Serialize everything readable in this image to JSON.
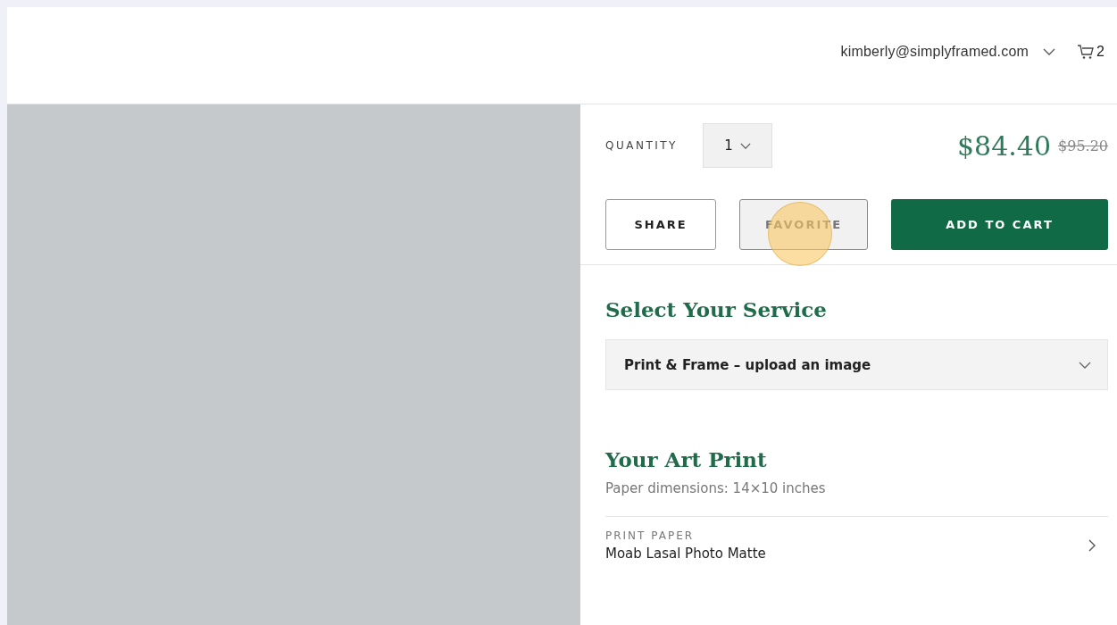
{
  "header": {
    "account_email": "kimberly@simplyframed.com",
    "cart_count": "2"
  },
  "purchase": {
    "quantity_label": "QUANTITY",
    "quantity": "1",
    "price": "$84.40",
    "original_price": "$95.20",
    "buttons": [
      {
        "label": "SHARE",
        "kind": "outline"
      },
      {
        "label": "FAVORITE",
        "kind": "muted"
      },
      {
        "label": "ADD TO CART",
        "kind": "primary"
      }
    ]
  },
  "service": {
    "heading": "Select Your Service",
    "value": "Print & Frame – upload an image"
  },
  "art_print": {
    "heading": "Your Art Print",
    "description": "Paper dimensions: 14×10 inches",
    "options": [
      {
        "label": "PRINT PAPER",
        "value": "Moab Lasal Photo Matte"
      }
    ]
  }
}
